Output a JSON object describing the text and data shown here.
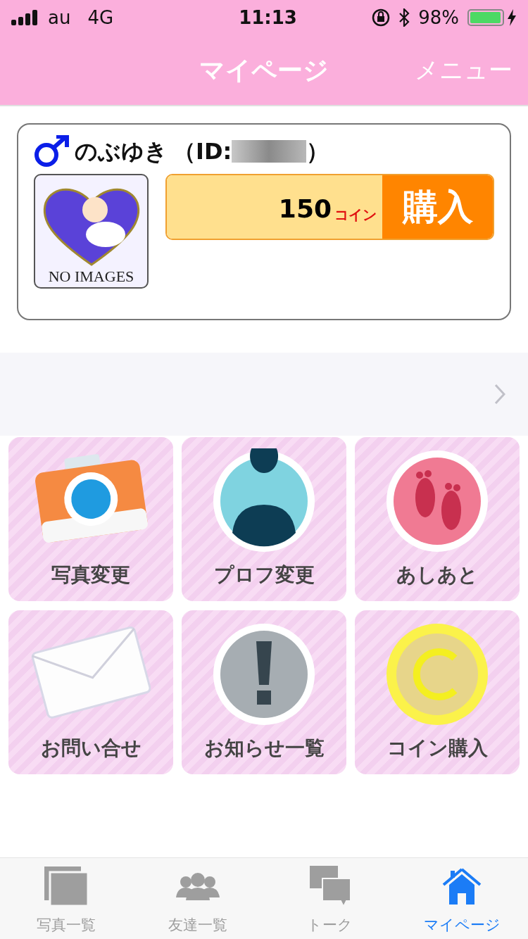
{
  "status_bar": {
    "carrier": "au",
    "network": "4G",
    "time": "11:13",
    "battery_text": "98%",
    "level": 0.98
  },
  "header": {
    "title": "マイページ",
    "menu": "メニュー"
  },
  "profile": {
    "name": "のぶゆき",
    "id_open": "（ID:",
    "id_close": "）",
    "avatar_caption": "NO IMAGES",
    "coins": "150",
    "coin_unit": "コイン",
    "buy": "購入"
  },
  "tiles": [
    {
      "kind": "camera",
      "label": "写真変更"
    },
    {
      "kind": "profile",
      "label": "プロフ変更"
    },
    {
      "kind": "footprints",
      "label": "あしあと"
    },
    {
      "kind": "envelope",
      "label": "お問い合せ"
    },
    {
      "kind": "notice",
      "label": "お知らせ一覧"
    },
    {
      "kind": "coin",
      "label": "コイン購入"
    }
  ],
  "tab_bar": [
    {
      "kind": "photos",
      "label": "写真一覧",
      "selected": false
    },
    {
      "kind": "friends",
      "label": "友達一覧",
      "selected": false
    },
    {
      "kind": "talk",
      "label": "トーク",
      "selected": false
    },
    {
      "kind": "home",
      "label": "マイページ",
      "selected": true
    }
  ]
}
